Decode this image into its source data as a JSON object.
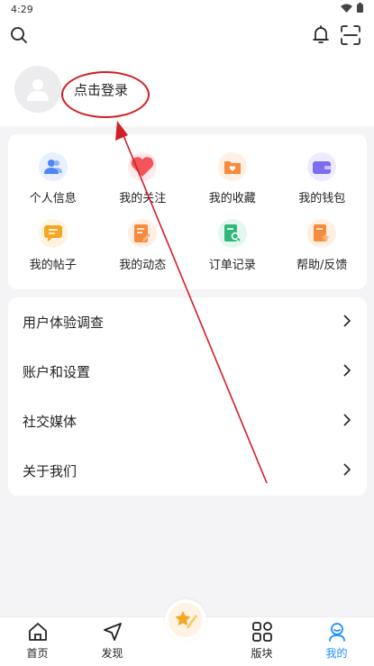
{
  "status_bar": {
    "time": "4:29"
  },
  "profile": {
    "login_text": "点击登录"
  },
  "grid": [
    {
      "label": "个人信息",
      "icon": "users-icon",
      "color": "#4f86f7",
      "bg": "#e8f0ff"
    },
    {
      "label": "我的关注",
      "icon": "heart-icon",
      "color": "#f2555a",
      "bg": "#ffe9ea"
    },
    {
      "label": "我的收藏",
      "icon": "favorite-folder-icon",
      "color": "#f78a3b",
      "bg": "#fff0e3"
    },
    {
      "label": "我的钱包",
      "icon": "wallet-icon",
      "color": "#7b6cf0",
      "bg": "#eeeaff"
    },
    {
      "label": "我的帖子",
      "icon": "message-icon",
      "color": "#f5a623",
      "bg": "#fff4e0"
    },
    {
      "label": "我的动态",
      "icon": "edit-note-icon",
      "color": "#f78a3b",
      "bg": "#fff0e3"
    },
    {
      "label": "订单记录",
      "icon": "order-search-icon",
      "color": "#2fb879",
      "bg": "#e3f7ee"
    },
    {
      "label": "帮助/反馈",
      "icon": "help-star-icon",
      "color": "#f78a3b",
      "bg": "#fff0e3"
    }
  ],
  "list": [
    {
      "label": "用户体验调查"
    },
    {
      "label": "账户和设置"
    },
    {
      "label": "社交媒体"
    },
    {
      "label": "关于我们"
    }
  ],
  "nav": [
    {
      "label": "首页",
      "icon": "home-icon",
      "active": false
    },
    {
      "label": "发现",
      "icon": "navigation-icon",
      "active": false
    },
    {
      "label": "",
      "icon": "star-pen-icon",
      "active": false
    },
    {
      "label": "版块",
      "icon": "grid-icon",
      "active": false
    },
    {
      "label": "我的",
      "icon": "profile-icon",
      "active": true
    }
  ],
  "colors": {
    "accent": "#1e90ff",
    "annotation": "#d21f24",
    "text": "#222222",
    "background": "#f4f4f6"
  }
}
